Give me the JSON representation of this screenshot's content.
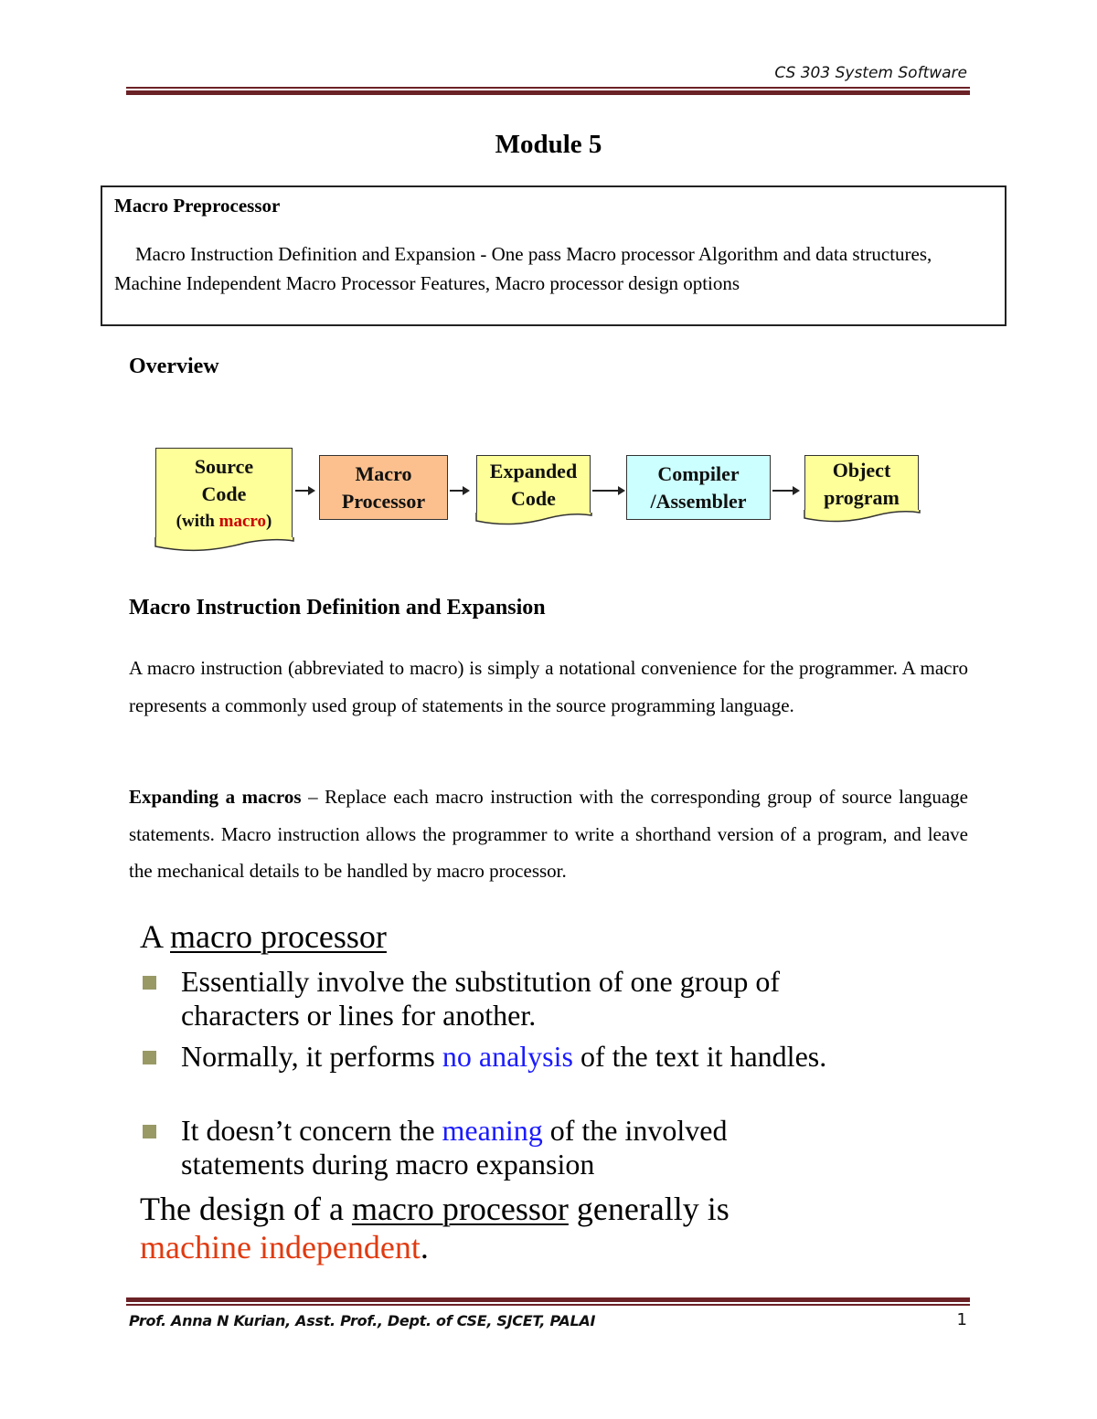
{
  "header": {
    "course_title": "CS 303 System Software",
    "rule_color": "#6b2226"
  },
  "module_title": "Module 5",
  "topic_box": {
    "heading": "Macro Preprocessor",
    "description": "Macro Instruction Definition and Expansion - One pass Macro processor Algorithm and data structures, Machine Independent Macro Processor Features, Macro processor design options"
  },
  "overview": {
    "heading": "Overview",
    "flow": [
      {
        "line1": "Source",
        "line2": "Code",
        "line3_prefix": "(with ",
        "line3_highlight": "macro",
        "line3_suffix": ")",
        "shape": "document",
        "color": "#ffff99"
      },
      {
        "line1": "Macro",
        "line2": "Processor",
        "shape": "box",
        "color": "#fbc08e"
      },
      {
        "line1": "Expanded",
        "line2": "Code",
        "shape": "document",
        "color": "#ffff99"
      },
      {
        "line1": "Compiler",
        "line2": "/Assembler",
        "shape": "box",
        "color": "#ccffff"
      },
      {
        "line1": "Object",
        "line2": "program",
        "shape": "document",
        "color": "#ffff99"
      }
    ]
  },
  "section": {
    "heading": "Macro Instruction Definition and Expansion",
    "para1": "A macro instruction (abbreviated to macro) is simply a notational convenience for the programmer. A macro represents a commonly used group of statements in the source programming language.",
    "para2_bold": "Expanding a macros",
    "para2_rest": " – Replace each macro instruction with the corresponding group of source language statements. Macro instruction allows the programmer to write a shorthand version of a program, and leave the mechanical details to be handled by macro processor."
  },
  "slide": {
    "title_prefix": "A ",
    "title_underlined": "macro processor",
    "bullets": [
      {
        "before": "Essentially involve the substitution of one group of characters or lines for another.",
        "highlight": "",
        "after": ""
      },
      {
        "before": "Normally, it performs ",
        "highlight": "no analysis",
        "after": " of the text it handles."
      },
      {
        "before": "It doesn’t concern the ",
        "highlight": "meaning",
        "after": " of the involved statements during macro expansion"
      }
    ],
    "footer_prefix": "The design of a ",
    "footer_underlined": "macro processor",
    "footer_middle": " generally is ",
    "footer_highlight": "machine independent",
    "footer_end": "."
  },
  "footer": {
    "author": "Prof. Anna N Kurian, Asst. Prof., Dept. of CSE, SJCET, PALAI",
    "page_number": "1"
  }
}
